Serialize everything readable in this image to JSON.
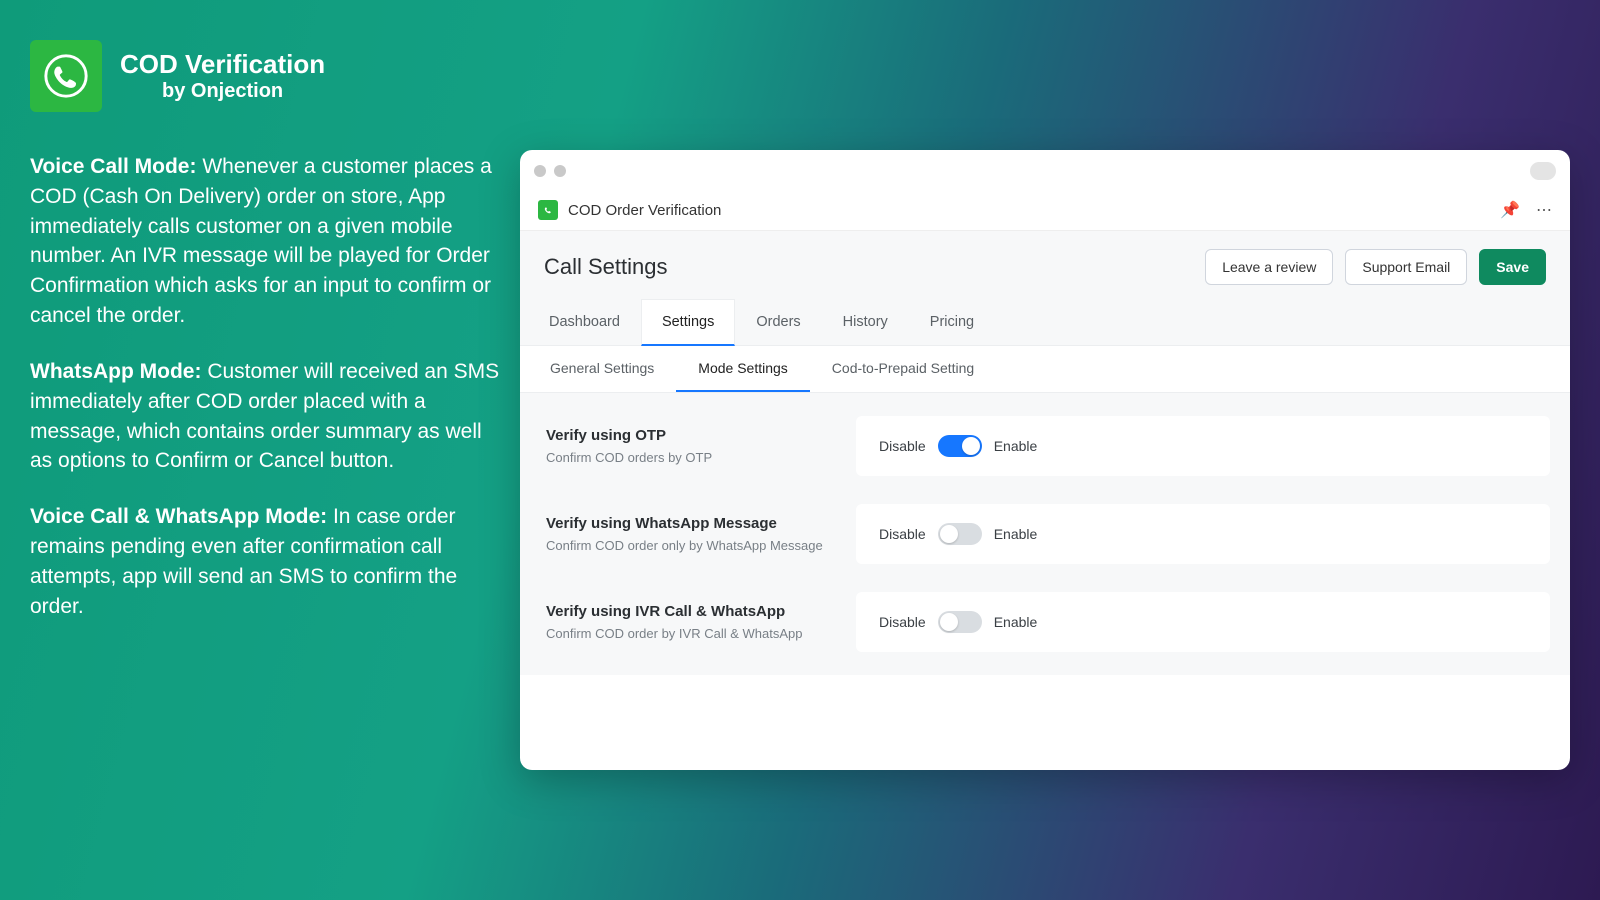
{
  "brand": {
    "title": "COD Verification",
    "subtitle": "by Onjection"
  },
  "marketing": {
    "p1_bold": "Voice Call Mode:",
    "p1_rest": " Whenever a customer places a COD (Cash On Delivery) order on store, App immediately calls customer on a given mobile number. An IVR message will be played for Order Confirmation which asks for an input to confirm or cancel the order.",
    "p2_bold": "WhatsApp Mode:",
    "p2_rest": " Customer will received an SMS immediately after COD order placed with a message, which contains order summary as well as options to Confirm or Cancel button.",
    "p3_bold": "Voice Call & WhatsApp Mode:",
    "p3_rest": " In case order remains pending even after confirmation call attempts, app will send an SMS to confirm the order."
  },
  "app": {
    "bar_title": "COD Order Verification",
    "page_title": "Call Settings",
    "buttons": {
      "review": "Leave a review",
      "support": "Support Email",
      "save": "Save"
    },
    "tabs": [
      "Dashboard",
      "Settings",
      "Orders",
      "History",
      "Pricing"
    ],
    "active_tab": 1,
    "subtabs": [
      "General Settings",
      "Mode Settings",
      "Cod-to-Prepaid Setting"
    ],
    "active_subtab": 1,
    "toggle_labels": {
      "off": "Disable",
      "on": "Enable"
    },
    "settings": [
      {
        "title": "Verify using OTP",
        "sub": "Confirm COD orders by OTP",
        "enabled": true
      },
      {
        "title": "Verify using WhatsApp Message",
        "sub": "Confirm COD order only by WhatsApp Message",
        "enabled": false
      },
      {
        "title": "Verify using IVR Call & WhatsApp",
        "sub": "Confirm COD order by IVR Call & WhatsApp",
        "enabled": false
      }
    ]
  }
}
